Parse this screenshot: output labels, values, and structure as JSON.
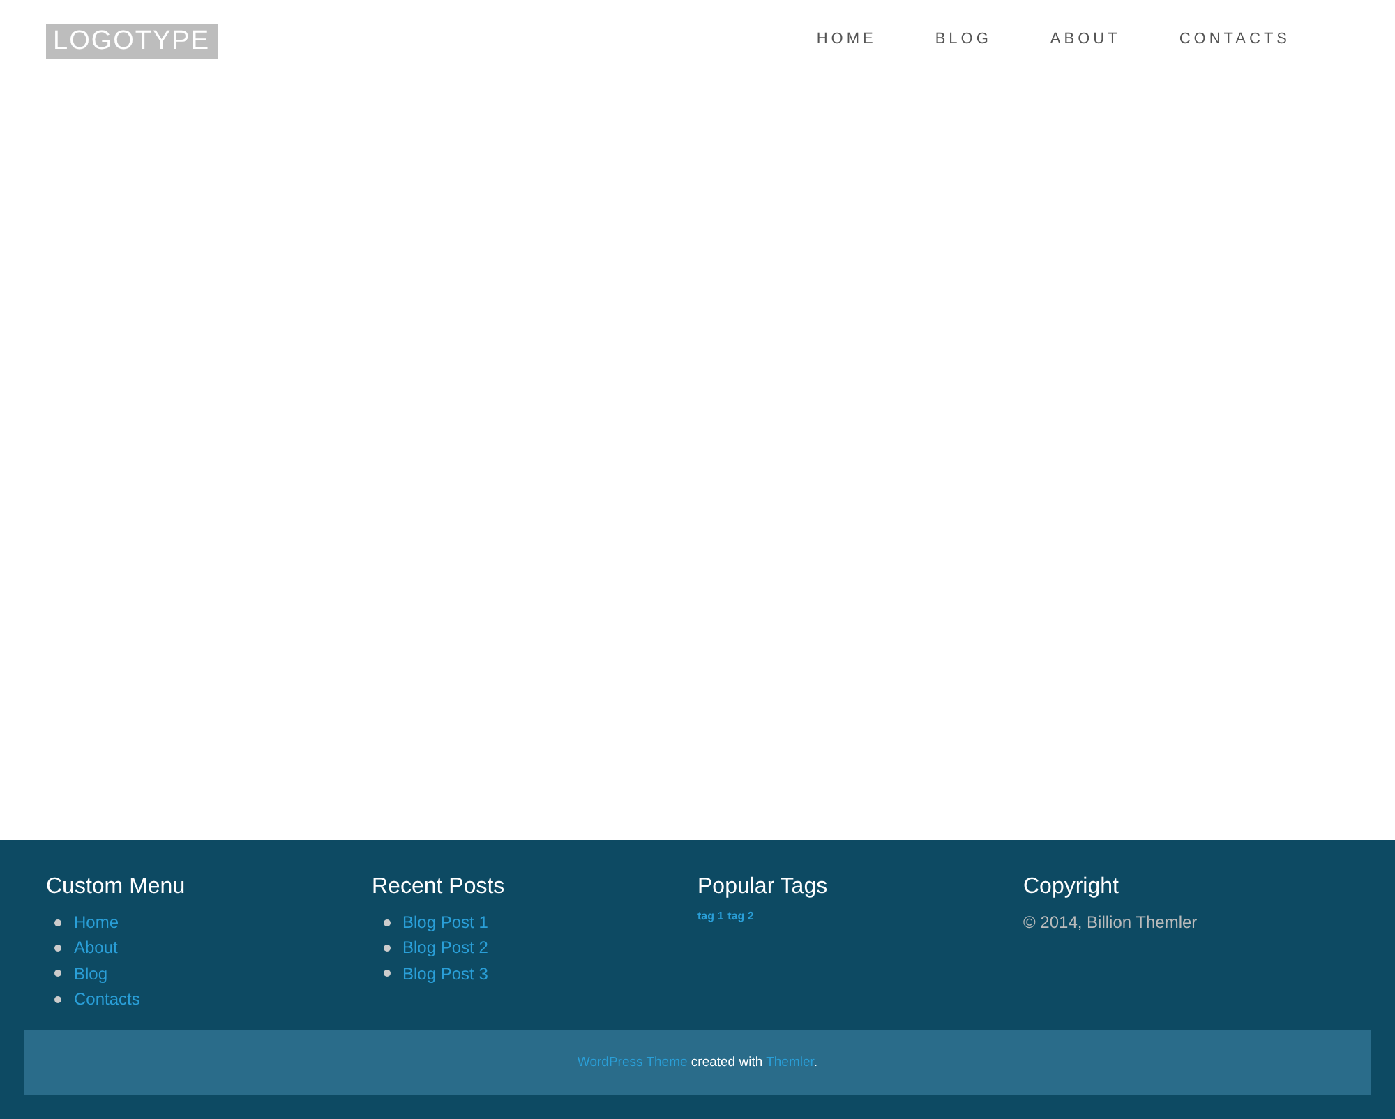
{
  "header": {
    "logo": "LOGOTYPE",
    "nav": [
      {
        "label": "HOME"
      },
      {
        "label": "BLOG"
      },
      {
        "label": "ABOUT"
      },
      {
        "label": "CONTACTS"
      }
    ]
  },
  "footer": {
    "custom_menu": {
      "title": "Custom Menu",
      "items": [
        "Home",
        "About",
        "Blog",
        "Contacts"
      ]
    },
    "recent_posts": {
      "title": "Recent Posts",
      "items": [
        "Blog Post 1",
        "Blog Post 2",
        "Blog Post 3"
      ]
    },
    "popular_tags": {
      "title": "Popular Tags",
      "tags": [
        "tag 1",
        "tag 2"
      ]
    },
    "copyright": {
      "title": "Copyright",
      "text": "© 2014, Billion Themler"
    },
    "credit": {
      "theme_link": "WordPress Theme",
      "text": "created with",
      "tool_link": "Themler",
      "end": "."
    }
  }
}
